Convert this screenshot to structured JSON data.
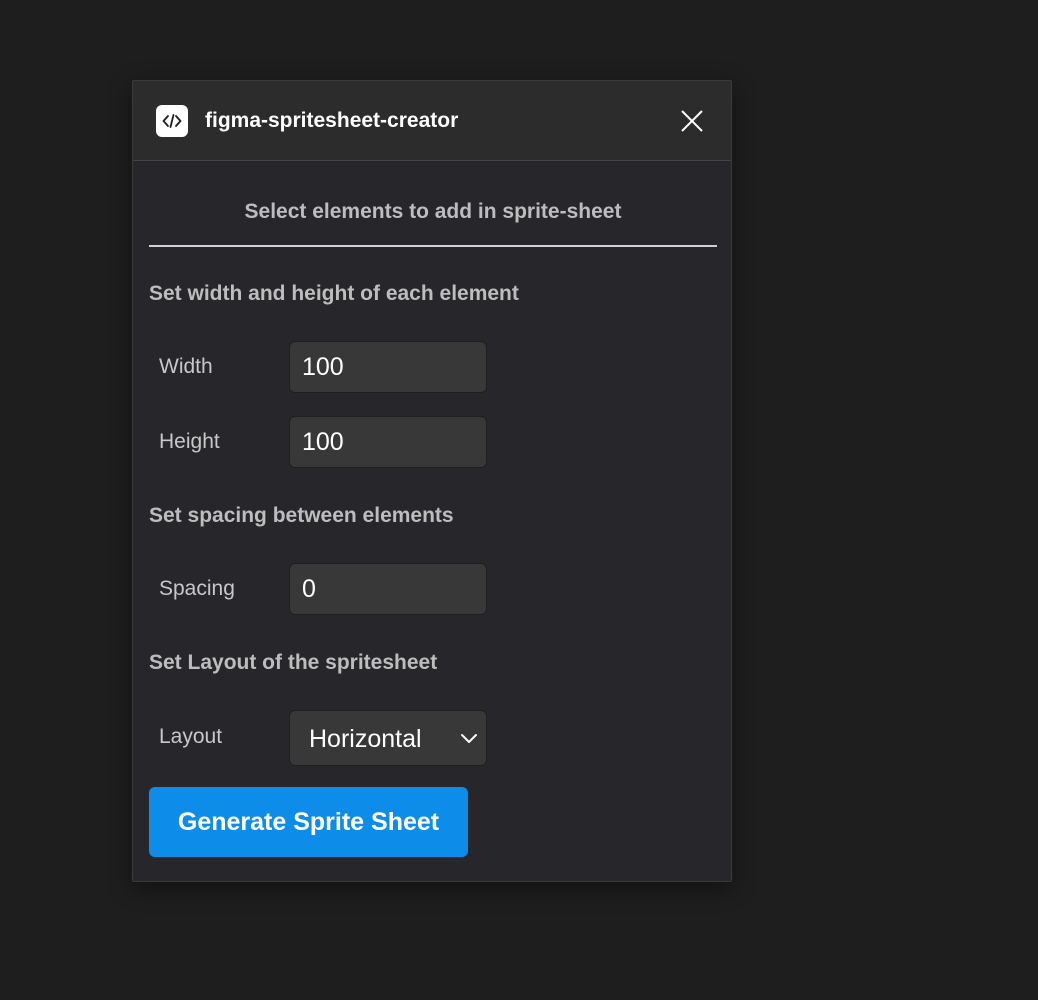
{
  "window": {
    "title": "figma-spritesheet-creator",
    "icon": "code-icon",
    "close_icon": "close-icon"
  },
  "instructions": "Select elements to add in sprite-sheet",
  "dimensions": {
    "heading": "Set width and height of each element",
    "width_label": "Width",
    "width_value": "100",
    "height_label": "Height",
    "height_value": "100"
  },
  "spacing": {
    "heading": "Set spacing between elements",
    "label": "Spacing",
    "value": "0"
  },
  "layout": {
    "heading": "Set Layout of the spritesheet",
    "label": "Layout",
    "selected": "Horizontal"
  },
  "actions": {
    "generate_label": "Generate Sprite Sheet"
  },
  "colors": {
    "background": "#1e1e1e",
    "panel": "#27272b",
    "accent": "#0d8ce9"
  }
}
